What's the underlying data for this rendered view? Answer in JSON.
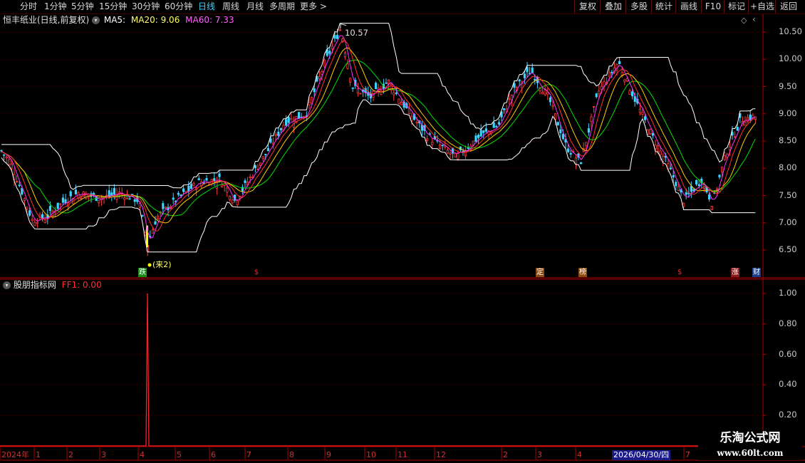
{
  "toolbar": {
    "periods": [
      "分时",
      "1分钟",
      "5分钟",
      "15分钟",
      "30分钟",
      "60分钟",
      "日线",
      "周线",
      "月线",
      "多周期",
      "更多"
    ],
    "active_period": "日线",
    "more_arrow": ">",
    "right_buttons": [
      "复权",
      "叠加",
      "多股",
      "统计",
      "画线",
      "F10",
      "标记",
      "+自选",
      "返回"
    ]
  },
  "main_panel": {
    "stock_title": "恒丰纸业(日线,前复权)",
    "ma5_label": "MA5:",
    "ma20_label": "MA20: 9.06",
    "ma60_label": "MA60: 7.33",
    "high_marker": "10.57",
    "low_marker_note": "(来2)",
    "y_ticks": [
      "10.50",
      "10.00",
      "9.50",
      "9.00",
      "8.50",
      "8.00",
      "7.50",
      "7.00",
      "6.50"
    ]
  },
  "indicator_panel": {
    "title": "股朋指标网",
    "ff1_label": "FF1: 0.00",
    "y_ticks": [
      "1.00",
      "0.80",
      "0.60",
      "0.40",
      "0.20"
    ]
  },
  "x_axis": {
    "labels": [
      "2024年",
      "1",
      "2",
      "3",
      "4",
      "5",
      "6",
      "7",
      "8",
      "9",
      "10",
      "11",
      "12",
      "2",
      "3",
      "4",
      "7"
    ],
    "cursor_date": "2026/04/30/四"
  },
  "events": [
    {
      "label": "跌",
      "color": "#1a8a1a"
    },
    {
      "label": "$",
      "color": "#000000",
      "text_color": "#e03030"
    },
    {
      "label": "定",
      "color": "#8a4a10"
    },
    {
      "label": "榜",
      "color": "#8a4a10"
    },
    {
      "label": "$",
      "color": "#000000",
      "text_color": "#e03030"
    },
    {
      "label": "涨",
      "color": "#8a1a1a"
    },
    {
      "label": "财",
      "color": "#1a3a8a"
    }
  ],
  "colors": {
    "up": "#ff3c3c",
    "down": "#3fd3ff",
    "ma5": "#ffffff",
    "ma20": "#ffff00",
    "ma60": "#ff00ff",
    "ma_green": "#00ff00",
    "band": "#ffffff",
    "grid": "#5a0000",
    "axis": "#b00000",
    "ff1": "#ff2020"
  },
  "watermark": {
    "title": "乐淘公式网",
    "url": "www.60lt.com"
  },
  "chart_data": {
    "type": "line",
    "title": "恒丰纸业(日线,前复权)",
    "ylim": [
      6.3,
      10.75
    ],
    "price_key_points": [
      {
        "x": 0,
        "y": 8.35
      },
      {
        "x": 15,
        "y": 8.1
      },
      {
        "x": 30,
        "y": 7.6
      },
      {
        "x": 45,
        "y": 7.05
      },
      {
        "x": 65,
        "y": 7.1
      },
      {
        "x": 90,
        "y": 7.4
      },
      {
        "x": 110,
        "y": 7.55
      },
      {
        "x": 140,
        "y": 7.45
      },
      {
        "x": 170,
        "y": 7.55
      },
      {
        "x": 195,
        "y": 7.4
      },
      {
        "x": 207,
        "y": 6.6
      },
      {
        "x": 220,
        "y": 7.1
      },
      {
        "x": 250,
        "y": 7.45
      },
      {
        "x": 280,
        "y": 7.75
      },
      {
        "x": 310,
        "y": 7.8
      },
      {
        "x": 330,
        "y": 7.4
      },
      {
        "x": 350,
        "y": 7.8
      },
      {
        "x": 375,
        "y": 8.3
      },
      {
        "x": 400,
        "y": 8.85
      },
      {
        "x": 430,
        "y": 9.0
      },
      {
        "x": 455,
        "y": 9.9
      },
      {
        "x": 478,
        "y": 10.57
      },
      {
        "x": 495,
        "y": 9.5
      },
      {
        "x": 520,
        "y": 9.3
      },
      {
        "x": 545,
        "y": 9.6
      },
      {
        "x": 570,
        "y": 9.1
      },
      {
        "x": 600,
        "y": 8.6
      },
      {
        "x": 640,
        "y": 8.2
      },
      {
        "x": 670,
        "y": 8.55
      },
      {
        "x": 700,
        "y": 8.8
      },
      {
        "x": 720,
        "y": 9.4
      },
      {
        "x": 745,
        "y": 9.8
      },
      {
        "x": 770,
        "y": 9.3
      },
      {
        "x": 795,
        "y": 8.4
      },
      {
        "x": 815,
        "y": 8.1
      },
      {
        "x": 840,
        "y": 9.4
      },
      {
        "x": 868,
        "y": 9.95
      },
      {
        "x": 890,
        "y": 9.3
      },
      {
        "x": 915,
        "y": 8.6
      },
      {
        "x": 940,
        "y": 8.0
      },
      {
        "x": 960,
        "y": 7.4
      },
      {
        "x": 985,
        "y": 7.8
      },
      {
        "x": 1000,
        "y": 7.35
      },
      {
        "x": 1020,
        "y": 8.3
      },
      {
        "x": 1040,
        "y": 8.9
      },
      {
        "x": 1062,
        "y": 8.95
      }
    ],
    "ff1_spike": {
      "x": 207,
      "value": 1.0
    }
  }
}
